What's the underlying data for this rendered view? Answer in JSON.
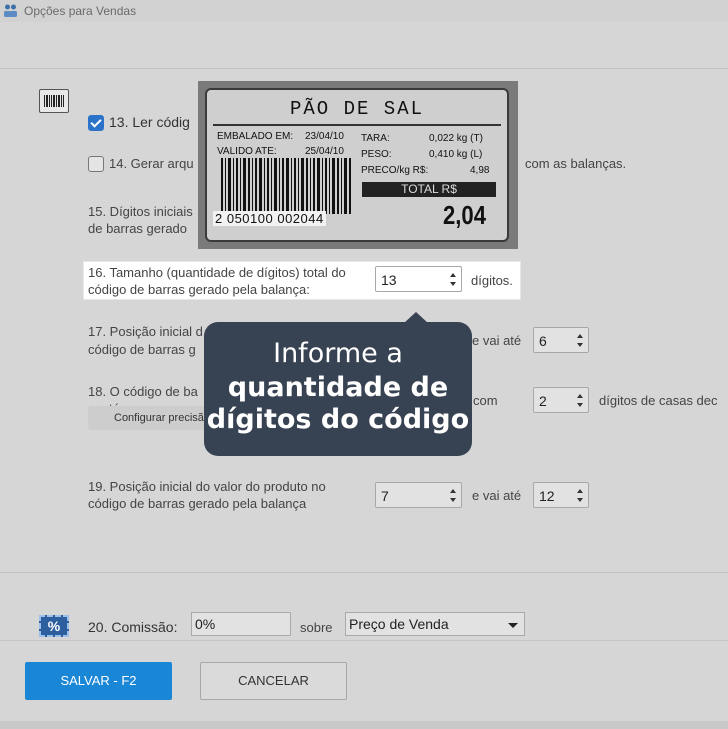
{
  "window": {
    "title": "Opções para Vendas",
    "app_icon": "people-icon"
  },
  "options": {
    "opt13": {
      "label": "13. Ler códig",
      "checked": true
    },
    "opt14": {
      "label_left": "14. Gerar arqu",
      "label_right": "com as balanças.",
      "checked": false
    },
    "opt15": {
      "line1": "15. Dígitos iniciais",
      "line2": "de barras gerado"
    },
    "opt16": {
      "line1": "16. Tamanho (quantidade de dígitos) total do",
      "line2": "código de barras gerado pela balança:",
      "value": "13",
      "suffix": "dígitos."
    },
    "opt17": {
      "line1": "17. Posição inicial d",
      "line2": "código de barras g",
      "connector": "e vai até",
      "value_end": "6"
    },
    "opt18": {
      "line1": "18. O código de ba",
      "line2": "contém o peso ou",
      "connector": "com",
      "value": "2",
      "suffix": "dígitos de casas dec",
      "config_button": "Configurar precisã"
    },
    "opt19": {
      "line1": "19. Posição inicial do valor do produto no",
      "line2": "código de barras gerado pela balança",
      "value_start": "7",
      "connector": "e vai até",
      "value_end": "12"
    },
    "opt20": {
      "label": "20. Comissão:",
      "value": "0%",
      "connector": "sobre",
      "select_value": "Preço de Venda"
    }
  },
  "scale_label": {
    "product": "PÃO DE SAL",
    "packed_label": "EMBALADO EM:",
    "packed_date": "23/04/10",
    "valid_label": "VALIDO ATE:",
    "valid_date": "25/04/10",
    "tare_label": "TARA:",
    "tare_value": "0,022 kg (T)",
    "weight_label": "PESO:",
    "weight_value": "0,410 kg (L)",
    "price_label": "PRECO/kg R$:",
    "price_value": "4,98",
    "total_label": "TOTAL R$",
    "total_value": "2,04",
    "barcode_number": "2 050100 002044"
  },
  "tooltip": {
    "line1": "Informe a",
    "line2": "quantidade de",
    "line3": "dígitos do código"
  },
  "footer": {
    "save_label": "SALVAR - F2",
    "cancel_label": "CANCELAR"
  },
  "icons": {
    "opt13_icon": "barcode-icon",
    "opt20_icon": "percent-icon"
  },
  "colors": {
    "primary": "#1a86d6",
    "tooltip_bg": "#374252",
    "checkbox_on": "#2b73c8"
  }
}
